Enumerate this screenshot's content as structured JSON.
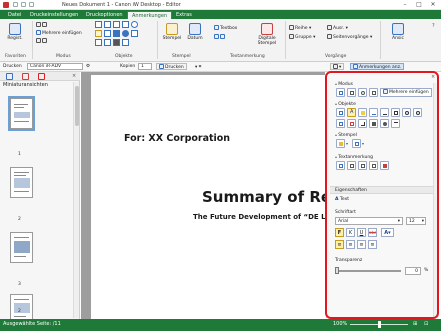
{
  "window": {
    "title": "Neues Dokument 1 - Canon iW Desktop - Editor",
    "controls": [
      "–",
      "□",
      "✕"
    ]
  },
  "tabs": [
    "Datei",
    "Druckeinstellungen",
    "Druckoptionen",
    "Anmerkungen",
    "Extras"
  ],
  "active_tab": "Anmerkungen",
  "ribbon": {
    "favoriten": {
      "label": "Favoriten",
      "register": "Regist."
    },
    "modus": {
      "label": "Modus"
    },
    "objekte": {
      "label": "Objekte",
      "multi_insert": "Mehrere einfügen"
    },
    "stempel": {
      "label": "Stempel",
      "stempel_btn": "Stempel",
      "datum_btn": "Datum"
    },
    "textanmerkung": {
      "label": "Textanmerkung",
      "textbox": "Textbox",
      "digital_stamp": "Digitale Stempel"
    },
    "vorgaenge": {
      "label": "Vorgänge",
      "reihe": "Reihe",
      "gruppe": "Gruppe",
      "ausr": "Ausr.",
      "seitenvorgaenge": "Seitenvorgänge"
    },
    "ansicht": {
      "label": "Ansic"
    }
  },
  "toolbar": {
    "drucken_label": "Drucken",
    "printer": "Canon iR-ADV",
    "kopien_label": "Kopien",
    "kopien_value": "1",
    "drucken_btn": "Drucken",
    "anmerkungen_anz": "Anmerkungen anz."
  },
  "left_panel": {
    "title": "Miniaturansichten",
    "thumbnails": [
      {
        "num": "1"
      },
      {
        "num": "2"
      },
      {
        "num": "3"
      },
      {
        "num": "2"
      }
    ]
  },
  "document": {
    "for_line": "For: XX Corporation",
    "title": "Summary of Rese",
    "subtitle": "The Future Development of “DE LA C"
  },
  "right_panel": {
    "modus": "Modus",
    "objekte": "Objekte",
    "multi_insert": "Mehrere einfügen",
    "stempel": "Stempel",
    "textanmerkung": "Textanmerkung",
    "eigenschaften": "Eigenschaften",
    "current_object": "Text",
    "schriftart": "Schriftart",
    "font_value": "Arial",
    "size_value": "12",
    "transparenz": "Transparenz",
    "transparenz_value": "0",
    "percent": "%",
    "format_buttons": [
      "F",
      "K",
      "U",
      "abc"
    ]
  },
  "status": {
    "left": "Ausgewählte Seite: /11",
    "zoom": "100%"
  },
  "colors": {
    "brand_green": "#1f7a3a",
    "highlight_red": "#e5141e",
    "selected_tool": "#fff2a8"
  }
}
